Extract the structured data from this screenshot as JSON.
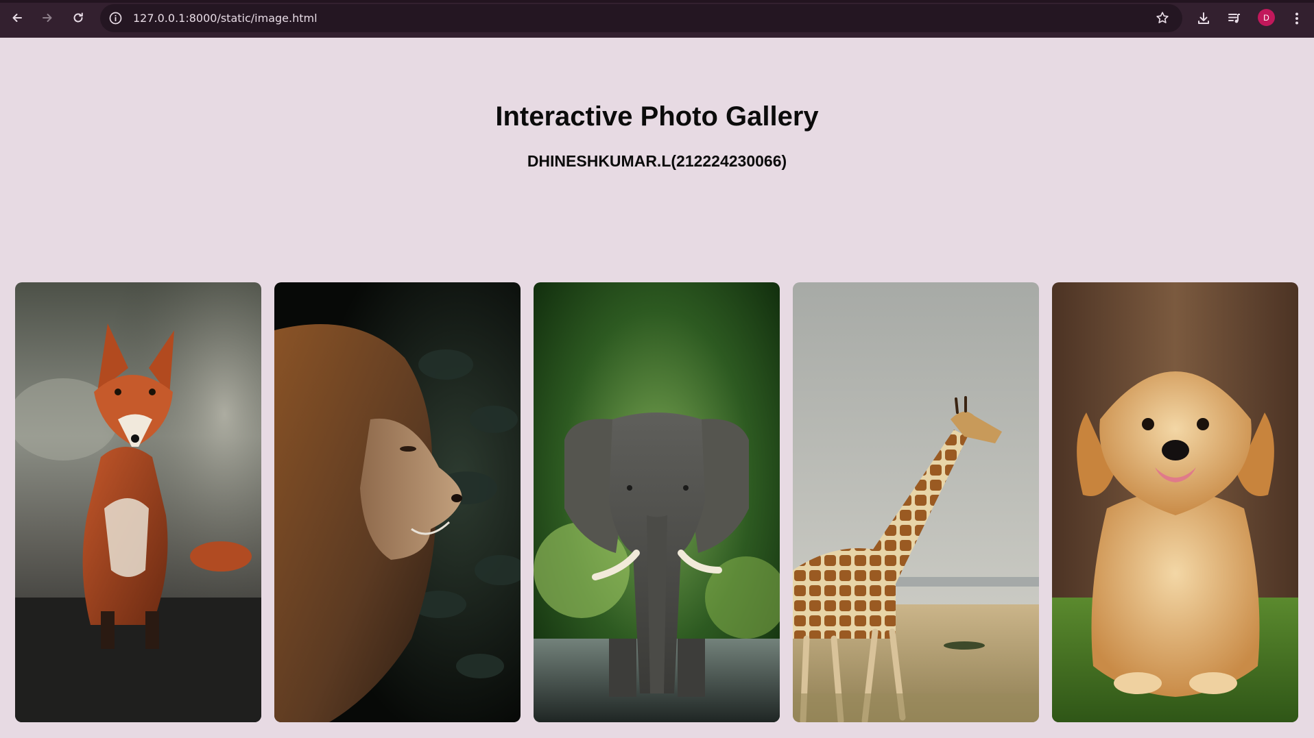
{
  "browser": {
    "url": "127.0.0.1:8000/static/image.html",
    "profile_initial": "D",
    "icons": [
      "back-icon",
      "forward-icon",
      "reload-icon",
      "site-info-icon",
      "bookmark-star-icon",
      "download-icon",
      "media-queue-icon",
      "menu-dots-icon"
    ],
    "colors": {
      "chrome": "#33202f",
      "omnibox": "#241622",
      "avatar": "#c2185b"
    }
  },
  "page": {
    "title": "Interactive Photo Gallery",
    "subtitle": "DHINESHKUMAR.L(212224230066)",
    "background": "#e7dae3"
  },
  "gallery": {
    "photos": [
      {
        "subject": "fox"
      },
      {
        "subject": "lion"
      },
      {
        "subject": "elephant"
      },
      {
        "subject": "giraffe"
      },
      {
        "subject": "puppy"
      }
    ]
  }
}
